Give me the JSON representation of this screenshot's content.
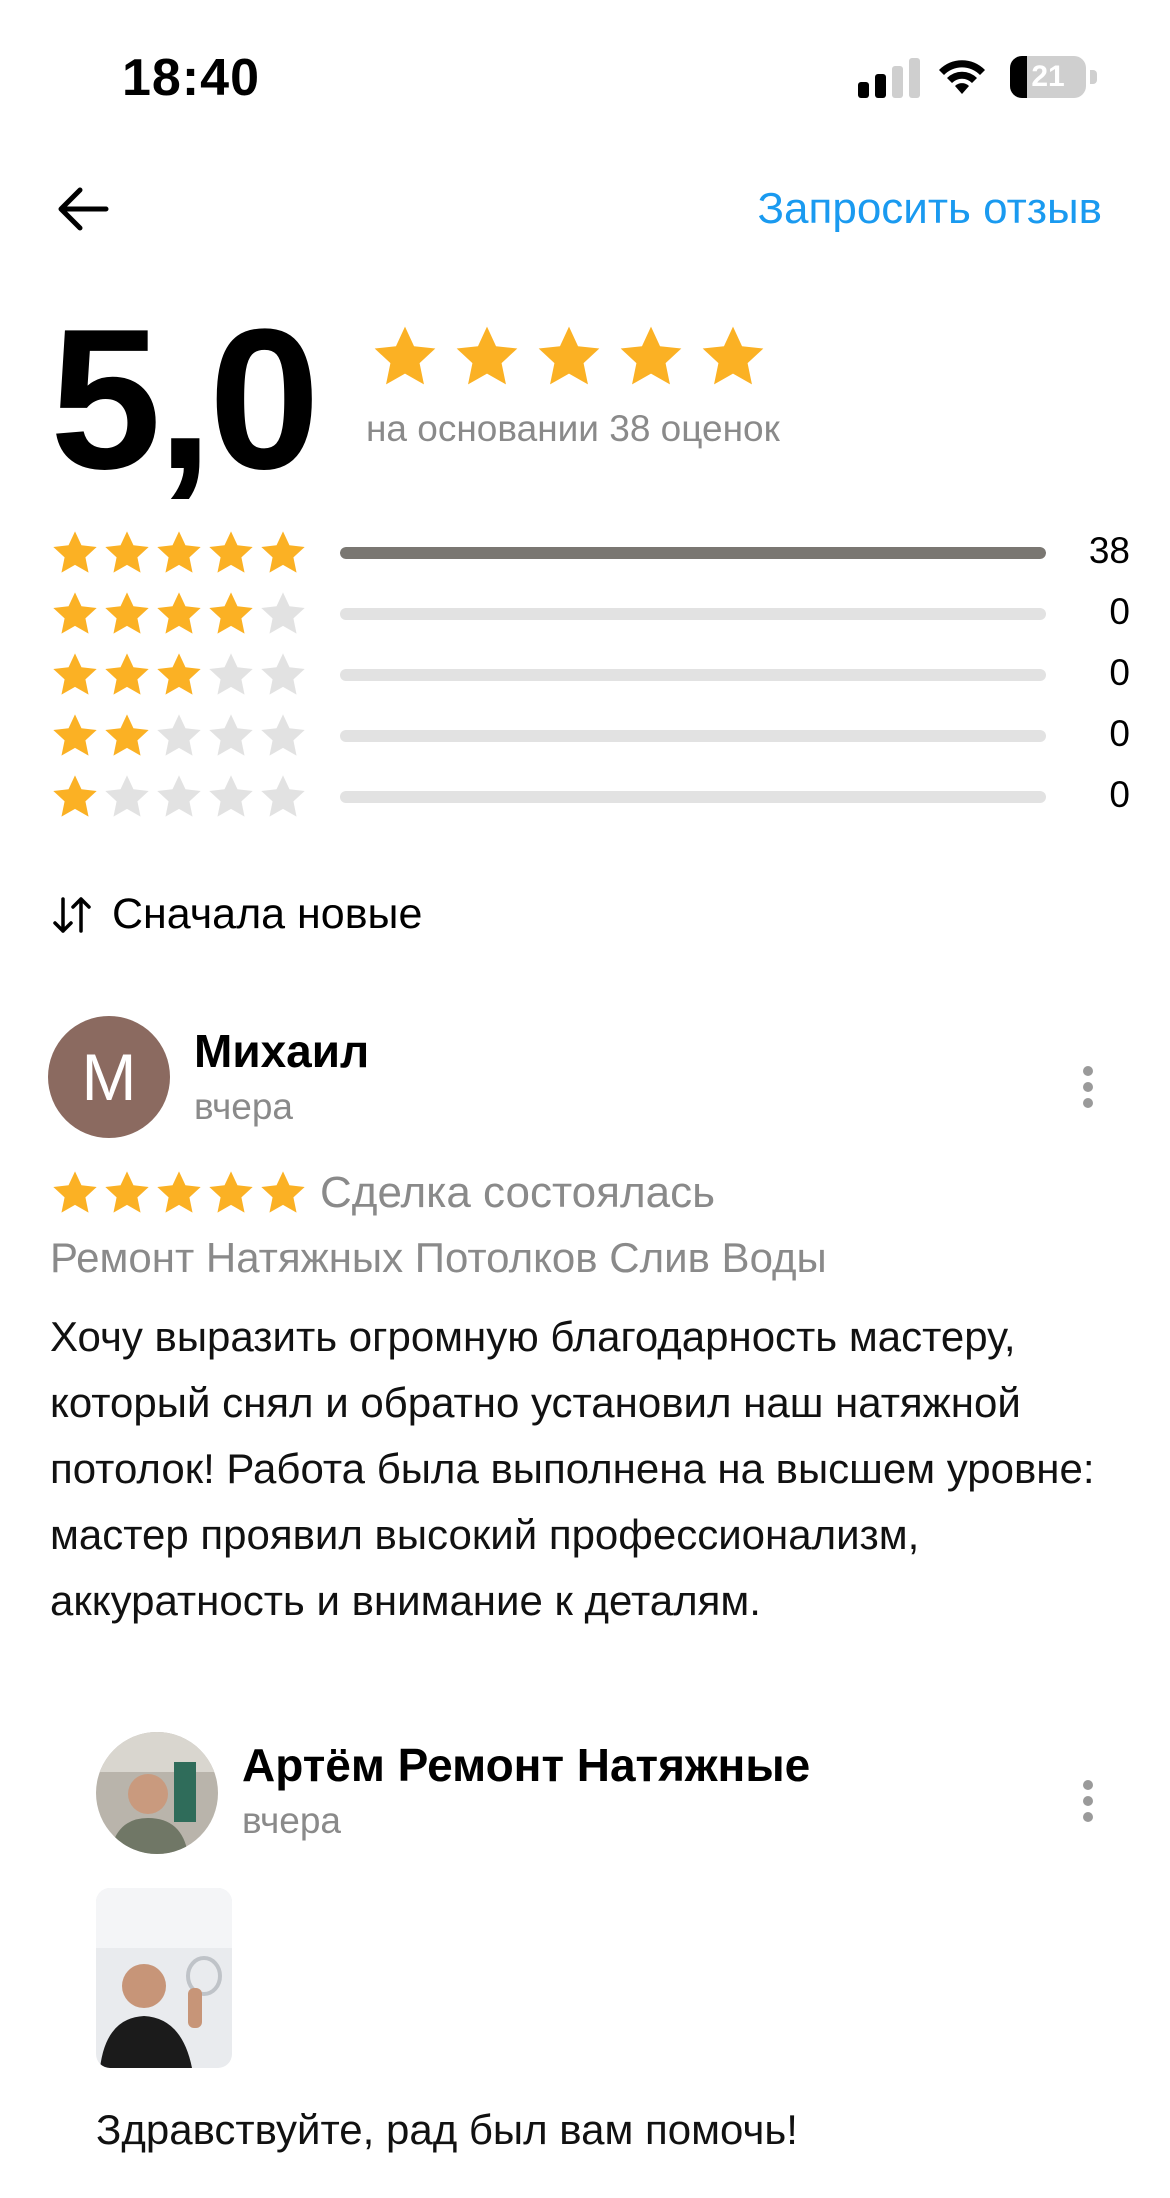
{
  "status_bar": {
    "time": "18:40",
    "battery": "21"
  },
  "header": {
    "request_review": "Запросить отзыв"
  },
  "summary": {
    "score": "5,0",
    "rating": 5,
    "basis": "на основании 38 оценок",
    "distribution": [
      {
        "stars": 5,
        "count": "38",
        "fraction": 1.0
      },
      {
        "stars": 4,
        "count": "0",
        "fraction": 0
      },
      {
        "stars": 3,
        "count": "0",
        "fraction": 0
      },
      {
        "stars": 2,
        "count": "0",
        "fraction": 0
      },
      {
        "stars": 1,
        "count": "0",
        "fraction": 0
      }
    ]
  },
  "sort": {
    "label": "Сначала новые"
  },
  "review": {
    "avatar_letter": "М",
    "author": "Михаил",
    "date": "вчера",
    "rating": 5,
    "deal": "Сделка состоялась",
    "service": "Ремонт Натяжных Потолков Слив Воды",
    "text": "Хочу выразить огромную благодарность мастеру, который снял и обратно установил наш натяжной потолок! Работа была выполнена на высшем уровне: мастер проявил высокий профессионализм, аккуратность и внимание к деталям.",
    "reply": {
      "author": "Артём Ремонт Натяжные",
      "date": "вчера",
      "text": "Здравствуйте, рад был вам помочь!"
    }
  },
  "colors": {
    "accent": "#1a9af0",
    "star_filled": "#fbb124",
    "star_empty": "#e2e2e2",
    "bar_filled": "#7a7772",
    "secondary_text": "#8a8a8a"
  }
}
